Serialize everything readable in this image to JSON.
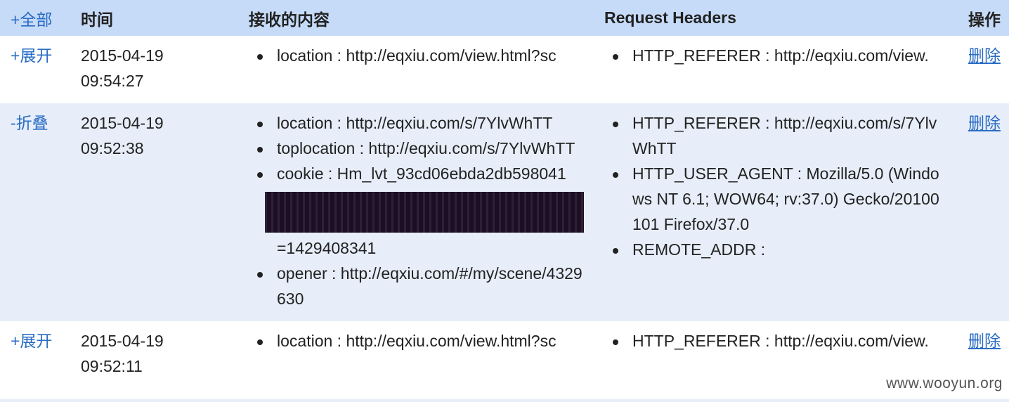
{
  "header": {
    "toggle_all": "+全部",
    "time": "时间",
    "content": "接收的内容",
    "request_headers": "Request Headers",
    "ops": "操作"
  },
  "rows": [
    {
      "toggle": "+展开",
      "date": "2015-04-19",
      "clock": "09:54:27",
      "content": [
        "location : http://eqxiu.com/view.html?sc"
      ],
      "headers": [
        "HTTP_REFERER : http://eqxiu.com/view."
      ],
      "delete": "删除"
    },
    {
      "toggle": "-折叠",
      "date": "2015-04-19",
      "clock": "09:52:38",
      "content": [
        "location : http://eqxiu.com/s/7YlvWhTT",
        "toplocation : http://eqxiu.com/s/7YlvWhTT",
        "cookie : Hm_lvt_93cd06ebda2db598041",
        "=1429408341",
        "opener : http://eqxiu.com/#/my/scene/4329630"
      ],
      "headers": [
        "HTTP_REFERER : http://eqxiu.com/s/7YlvWhTT",
        "HTTP_USER_AGENT : Mozilla/5.0 (Windows NT 6.1; WOW64; rv:37.0) Gecko/20100101 Firefox/37.0",
        "REMOTE_ADDR :"
      ],
      "delete": "删除"
    },
    {
      "toggle": "+展开",
      "date": "2015-04-19",
      "clock": "09:52:11",
      "content": [
        "location : http://eqxiu.com/view.html?sc"
      ],
      "headers": [
        "HTTP_REFERER : http://eqxiu.com/view."
      ],
      "delete": "删除"
    }
  ],
  "watermark": "www.wooyun.org"
}
